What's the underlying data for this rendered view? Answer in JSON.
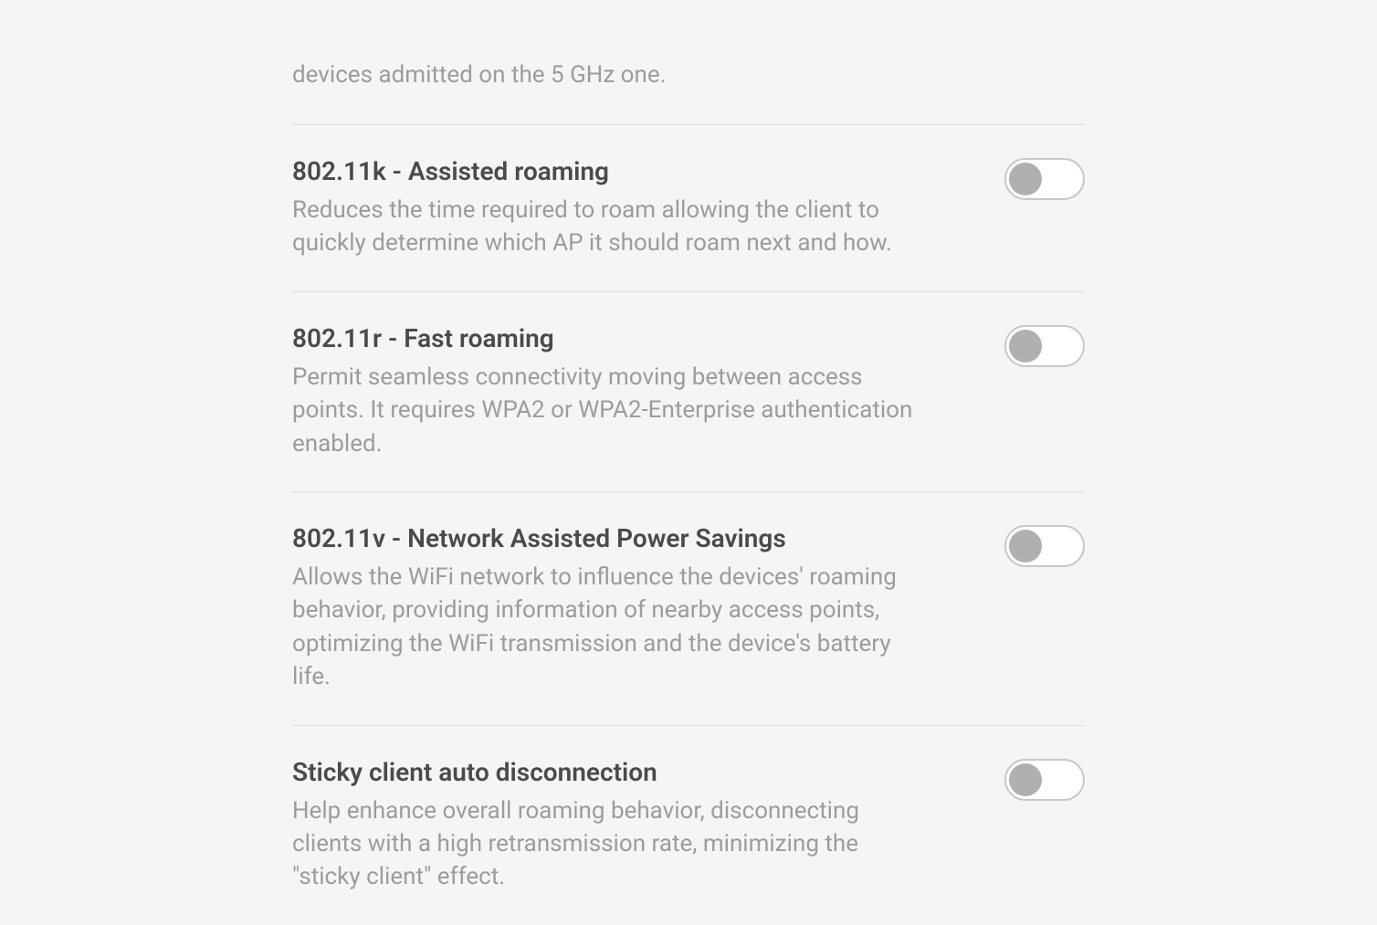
{
  "partial_row": {
    "description_fragment": "devices admitted on the 5 GHz one."
  },
  "settings": [
    {
      "id": "assisted-roaming",
      "title": "802.11k - Assisted roaming",
      "description": "Reduces the time required to roam allowing the client to quickly determine which AP it should roam next and how.",
      "enabled": false
    },
    {
      "id": "fast-roaming",
      "title": "802.11r - Fast roaming",
      "description": "Permit seamless connectivity moving between access points. It requires WPA2 or WPA2-Enterprise authentication enabled.",
      "enabled": false
    },
    {
      "id": "network-assisted-power-savings",
      "title": "802.11v - Network Assisted Power Savings",
      "description": "Allows the WiFi network to influence the devices' roaming behavior, providing information of nearby access points, optimizing the WiFi transmission and the device's battery life.",
      "enabled": false
    },
    {
      "id": "sticky-client-auto-disconnection",
      "title": "Sticky client auto disconnection",
      "description": "Help enhance overall roaming behavior, disconnecting clients with a high retransmission rate, minimizing the \"sticky client\" effect.",
      "enabled": false
    }
  ]
}
